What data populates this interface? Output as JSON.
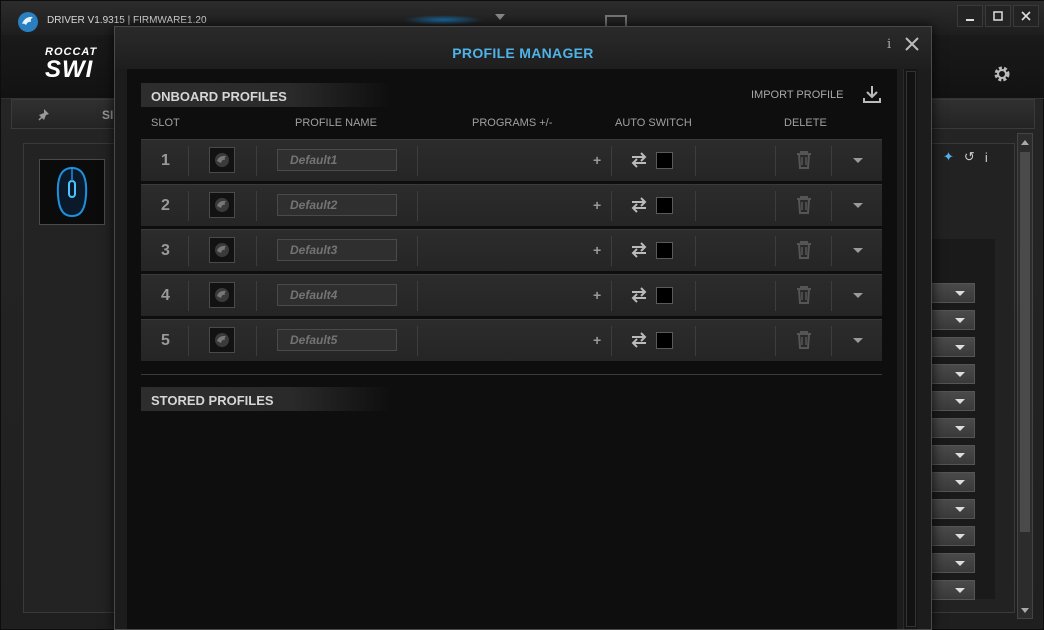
{
  "app": {
    "version": "DRIVER V1.9315 | FIRMWARE1.20",
    "brand_top": "ROCCAT",
    "brand_bottom": "SWI",
    "tab_label": "SI"
  },
  "window_controls": {
    "minimize": "minimize-icon",
    "maximize": "maximize-icon",
    "close": "close-icon"
  },
  "modal": {
    "title": "PROFILE MANAGER",
    "info": "i",
    "onboard_title": "ONBOARD PROFILES",
    "import_label": "IMPORT PROFILE",
    "stored_title": "STORED PROFILES",
    "columns": {
      "slot": "SLOT",
      "profile_name": "PROFILE NAME",
      "programs": "PROGRAMS +/-",
      "auto_switch": "AUTO SWITCH",
      "delete": "DELETE"
    },
    "profiles": [
      {
        "slot": "1",
        "name": "Default1",
        "add": "+"
      },
      {
        "slot": "2",
        "name": "Default2",
        "add": "+"
      },
      {
        "slot": "3",
        "name": "Default3",
        "add": "+"
      },
      {
        "slot": "4",
        "name": "Default4",
        "add": "+"
      },
      {
        "slot": "5",
        "name": "Default5",
        "add": "+"
      }
    ]
  },
  "right_panel": {
    "info": "i"
  },
  "colors": {
    "accent": "#4fb3e8",
    "background": "#1b1b1b",
    "row": "#2a2a2a"
  }
}
